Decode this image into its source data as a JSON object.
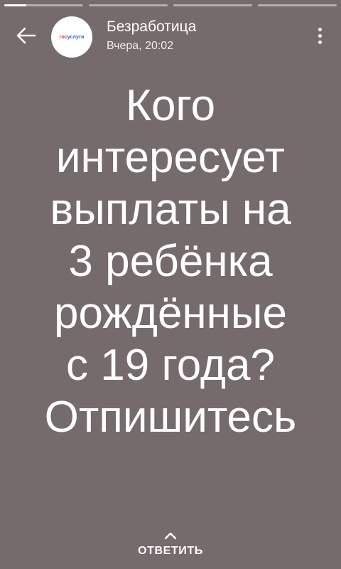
{
  "progress": {
    "segments": [
      {
        "fill": 0.28
      },
      {
        "fill": 0
      },
      {
        "fill": 0
      },
      {
        "fill": 0
      }
    ]
  },
  "header": {
    "channel_name": "Безработица",
    "timestamp": "Вчера, 20:02",
    "avatar_logo_text": "госуслуги"
  },
  "story": {
    "lines": [
      "Кого",
      "интересует",
      "выплаты на",
      "3 ребёнка",
      "рождённые",
      "с 19 года?",
      "Отпишитесь"
    ]
  },
  "reply": {
    "label": "ОТВЕТИТЬ"
  },
  "icons": {
    "back": "arrow-left-icon",
    "menu": "more-vertical-icon",
    "reply": "chevron-up-icon"
  },
  "colors": {
    "background": "#756a6c",
    "text": "#ffffff"
  }
}
